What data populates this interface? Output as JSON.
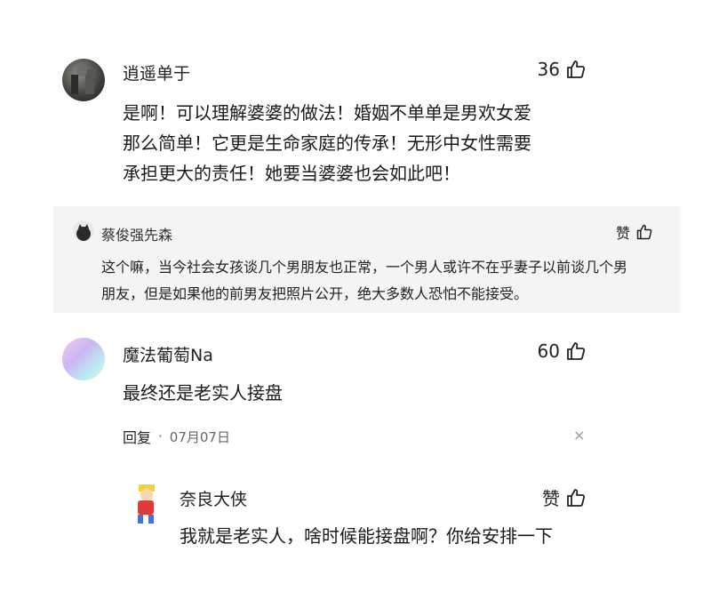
{
  "comments": [
    {
      "user": "逍遥单于",
      "likes": "36",
      "text_lines": [
        "是啊！可以理解婆婆的做法！婚姻不单单是男欢女爱",
        "那么简单！它更是生命家庭的传承！无形中女性需要",
        "承担更大的责任！她要当婆婆也会如此吧！"
      ],
      "reply": {
        "user": "蔡俊强先森",
        "like_label": "赞",
        "text_lines": [
          "这个嘛，当今社会女孩谈几个男朋友也正常，一个男人或许不在乎妻子以前谈几个男",
          "朋友，但是如果他的前男友把照片公开，绝大多数人恐怕不能接受。"
        ]
      }
    },
    {
      "user": "魔法葡萄Na",
      "likes": "60",
      "text": "最终还是老实人接盘",
      "reply_label": "回复",
      "dot": "·",
      "date": "07月07日",
      "close": "×",
      "reply": {
        "user": "奈良大侠",
        "like_label": "赞",
        "text": "我就是老实人，啥时候能接盘啊？你给安排一下"
      }
    }
  ],
  "icons": {
    "like": "thumbs-up-icon"
  },
  "colors": {
    "reply_bg": "#f4f4f4"
  }
}
